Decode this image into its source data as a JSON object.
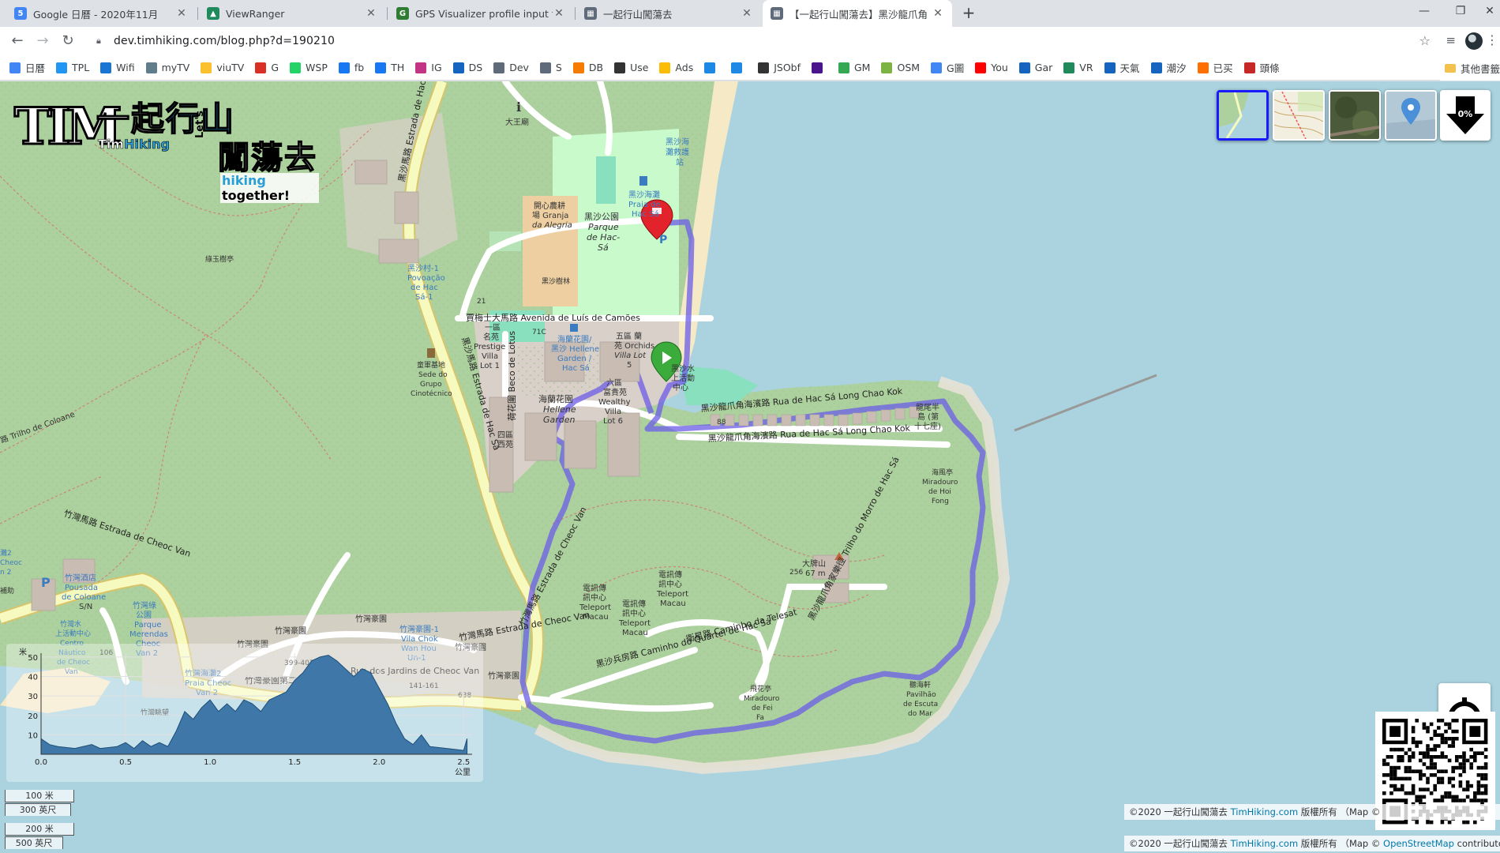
{
  "browser": {
    "tabs": [
      {
        "title": "Google 日曆 - 2020年11月",
        "favicon_color": "#4285f4",
        "favicon_text": "5"
      },
      {
        "title": "ViewRanger",
        "favicon_color": "#1f8a5c",
        "favicon_text": ""
      },
      {
        "title": "GPS Visualizer profile input form",
        "favicon_color": "#2e7d32",
        "favicon_text": "G"
      },
      {
        "title": "一起行山闖蕩去",
        "favicon_color": "#5f6b7a",
        "favicon_text": ""
      },
      {
        "title": "【一起行山闖蕩去】黑沙龍爪角",
        "favicon_color": "#5f6b7a",
        "favicon_text": ""
      }
    ],
    "active_tab_index": 4,
    "url": "dev.timhiking.com/blog.php?d=190210",
    "bookmarks": [
      {
        "label": "日曆",
        "color": "#4285f4"
      },
      {
        "label": "TPL",
        "color": "#2196f3"
      },
      {
        "label": "Wifi",
        "color": "#1976d2"
      },
      {
        "label": "myTV",
        "color": "#607d8b"
      },
      {
        "label": "viuTV",
        "color": "#fbc02d"
      },
      {
        "label": "G",
        "color": "#d93025"
      },
      {
        "label": "WSP",
        "color": "#25d366"
      },
      {
        "label": "fb",
        "color": "#1877f2"
      },
      {
        "label": "TH",
        "color": "#1877f2"
      },
      {
        "label": "IG",
        "color": "#c13584"
      },
      {
        "label": "DS",
        "color": "#1565c0"
      },
      {
        "label": "Dev",
        "color": "#5f6b7a"
      },
      {
        "label": "S",
        "color": "#5f6b7a"
      },
      {
        "label": "DB",
        "color": "#f57c00"
      },
      {
        "label": "Use",
        "color": "#333333"
      },
      {
        "label": "Ads",
        "color": "#fbbc04"
      },
      {
        "label": "",
        "color": "#1e88e5"
      },
      {
        "label": "",
        "color": "#1e88e5"
      },
      {
        "label": "JSObf",
        "color": "#333333"
      },
      {
        "label": "",
        "color": "#4a148c"
      },
      {
        "label": "GM",
        "color": "#34a853"
      },
      {
        "label": "OSM",
        "color": "#7cb342"
      },
      {
        "label": "G圖",
        "color": "#4285f4"
      },
      {
        "label": "You",
        "color": "#ff0000"
      },
      {
        "label": "Gar",
        "color": "#1565c0"
      },
      {
        "label": "VR",
        "color": "#1f8a5c"
      },
      {
        "label": "天氣",
        "color": "#1565c0"
      },
      {
        "label": "潮汐",
        "color": "#1565c0"
      },
      {
        "label": "已买",
        "color": "#ff6f00"
      },
      {
        "label": "頭條",
        "color": "#c62828"
      }
    ],
    "bookmarks_more": "»",
    "other_bookmarks": "其他書籤"
  },
  "map": {
    "logo": {
      "title_plain": "一起",
      "title_highlight": "行山",
      "subtitle_plain": "Tim",
      "subtitle_highlight": "Hiking",
      "lets": "Let's",
      "title2": "闖蕩去",
      "tagline_highlight": "hiking",
      "tagline_plain": " together!"
    },
    "layers": [
      "default-map",
      "topo-map",
      "satellite",
      "marker-view"
    ],
    "download_percent": "0%",
    "labels": {
      "dawang": "大王廟",
      "beach_station1": "黑沙海",
      "beach_station2": "灘救護",
      "beach_station3": "站",
      "beach_cn": "黑沙海灘",
      "beach_pt1": "Praia de",
      "beach_pt2": "Hac Sá",
      "park_cn": "黑沙公園",
      "park_pt1": "Parque",
      "park_pt2": "de Hac-",
      "park_pt3": "Sá",
      "farm1": "開心農耕",
      "farm2": "場 Granja",
      "farm3": "da Alegria",
      "pine": "黑沙樹林",
      "pavilion": "綠玉樹亭",
      "village1": "黑沙村-1",
      "village2": "Povoação",
      "village3": "de Hac",
      "village4": "Sá-1",
      "road_estrada_hac_sa": "黑沙馬路 Estrada de Hac Sá",
      "road_camoes": "賈梅士大馬路 Avenida de Luís de Camões",
      "prestige1": "一區",
      "prestige2": "名苑",
      "prestige3": "Prestige",
      "prestige4": "Villa",
      "prestige5": "Lot 1",
      "hellene1": "海蘭花園/",
      "hellene2": "黑沙 Hellene",
      "hellene3": "Garden /",
      "hellene4": "Hac Sá",
      "orchids1": "五區 蘭",
      "orchids2": "苑 Orchids",
      "orchids3": "Villa Lot",
      "orchids4": "5",
      "watersport1": "黑沙水",
      "watersport2": "上活動",
      "watersport3": "中心",
      "wealthy1": "六區",
      "wealthy2": "富貴苑",
      "wealthy3": "Wealthy",
      "wealthy4": "Villa",
      "wealthy5": "Lot 6",
      "hellene_garden1": "海蘭花園",
      "hellene_garden2": "Hellene",
      "hellene_garden3": "Garden",
      "west1": "四區",
      "west2": "西苑",
      "lotus": "荷花圍 Beco de Lotus",
      "scout1": "童軍基地",
      "scout2": "Sede do",
      "scout3": "Grupo",
      "scout4": "Cinotécnico",
      "coloane_trail": "路 Trilho de Coloane",
      "long_chao_kok_road": "黑沙龍爪角海濱路 Rua de Hac Sá Long Chao Kok",
      "long_chao_kok_road2": "黑沙龍爪角海濱路 Rua de Hac Sá Long Chao Kok",
      "dragon1": "龍尾半",
      "dragon2": "島 (第",
      "dragon3": "十七座)",
      "hoifong1": "海風亭",
      "hoifong2": "Miradouro",
      "hoifong3": "de Hoi",
      "hoifong4": "Fong",
      "cheoc_van_road": "竹灣馬路 Estrada de Cheoc Van",
      "cheoc_van_road2": "竹灣馬路 Estrada de Cheoc Van",
      "pousada1": "竹灣酒店",
      "pousada2": "Pousada",
      "pousada3": "de Coloane",
      "pousada4": "S/N",
      "parque1": "竹灣綠",
      "parque2": "公園",
      "parque3": "Parque",
      "parque4": "Merendas",
      "parque5": "Cheoc",
      "parque6": "Van 2",
      "teleport1": "電訊傳",
      "teleport2": "訊中心",
      "teleport3": "Teleport",
      "teleport4": "Macau",
      "quartel": "黑沙兵房路 Caminho do Quartel de Hac Sá",
      "telesat": "衛星路 Caminho da Telesat",
      "morro": "黑沙龍爪角家樂徑 Trilho do Morro de Hac Sá",
      "peak_cn": "大牌山",
      "peak_h": "67 m",
      "peak256": "256",
      "feifa1": "飛花亭",
      "feifa2": "Miradouro",
      "feifa3": "de Fei",
      "feifa4": "Fa",
      "escuta1": "聽海軒",
      "escuta2": "Pavilhão",
      "escuta3": "de Escuta",
      "escuta4": "do Mar",
      "cheocvan_vila1": "竹灣豪園",
      "cheocvan_vila2": "竹灣豪園第二街",
      "jardins": "Rua dos Jardins de Cheoc Van",
      "vila_chok1": "竹灣豪園-1",
      "vila_chok2": "Vila Chok",
      "vila_chok3": "Wan Hou",
      "vila_chok4": "Un-1",
      "num1": "399-407",
      "num2": "141-161",
      "num3": "638",
      "num4": "21",
      "num5": "88",
      "num6": "71C",
      "num7": "106",
      "beach_cheoc1": "竹灣海灘2",
      "beach_cheoc2": "Praia Cheoc",
      "beach_cheoc3": "Van 2",
      "centro1": "竹灣水",
      "centro2": "上活動中心",
      "centro3": "Centro",
      "centro4": "Náutico",
      "centro5": "de Cheoc",
      "centro6": "Van",
      "view_pavilion": "竹灣眺望",
      "left_edge1": "灘2",
      "left_edge2": "Cheoc",
      "left_edge3": "n 2",
      "left_edge4": "補助"
    }
  },
  "elevation": {
    "ylabel": "米",
    "xlabel": "公里",
    "yticks": [
      "10",
      "20",
      "30",
      "40",
      "50"
    ],
    "xticks": [
      "0.0",
      "0.5",
      "1.0",
      "1.5",
      "2.0",
      "2.5"
    ],
    "profile": [
      [
        0,
        8
      ],
      [
        0.05,
        5
      ],
      [
        0.1,
        4
      ],
      [
        0.2,
        3
      ],
      [
        0.3,
        5
      ],
      [
        0.35,
        3
      ],
      [
        0.45,
        4
      ],
      [
        0.5,
        6
      ],
      [
        0.55,
        3
      ],
      [
        0.6,
        7
      ],
      [
        0.65,
        4
      ],
      [
        0.7,
        6
      ],
      [
        0.75,
        4
      ],
      [
        0.8,
        12
      ],
      [
        0.85,
        22
      ],
      [
        0.9,
        18
      ],
      [
        0.95,
        24
      ],
      [
        1.0,
        28
      ],
      [
        1.05,
        22
      ],
      [
        1.1,
        26
      ],
      [
        1.15,
        22
      ],
      [
        1.2,
        28
      ],
      [
        1.25,
        26
      ],
      [
        1.3,
        22
      ],
      [
        1.35,
        28
      ],
      [
        1.4,
        30
      ],
      [
        1.45,
        32
      ],
      [
        1.5,
        38
      ],
      [
        1.55,
        42
      ],
      [
        1.6,
        48
      ],
      [
        1.65,
        50
      ],
      [
        1.7,
        51
      ],
      [
        1.75,
        48
      ],
      [
        1.8,
        44
      ],
      [
        1.85,
        40
      ],
      [
        1.9,
        44
      ],
      [
        1.95,
        42
      ],
      [
        2.0,
        34
      ],
      [
        2.05,
        26
      ],
      [
        2.1,
        16
      ],
      [
        2.15,
        8
      ],
      [
        2.2,
        5
      ],
      [
        2.25,
        10
      ],
      [
        2.3,
        4
      ],
      [
        2.4,
        3
      ],
      [
        2.5,
        2
      ],
      [
        2.52,
        8
      ]
    ]
  },
  "scales": [
    {
      "top": "100 米",
      "bottom": "300 英尺"
    },
    {
      "top": "200 米",
      "bottom": "500 英尺"
    }
  ],
  "attribution": {
    "line1_prefix": "©2020 一起行山闖蕩去 ",
    "line1_link": "TimHiking.com",
    "line1_suffix": " 版權所有 （Map ©",
    "line2_prefix": "©2020 一起行山闖蕩去 ",
    "line2_link": "TimHiking.com",
    "line2_mid": " 版權所有 （Map © ",
    "line2_link2": "OpenStreetMap",
    "line2_suffix": " contributors"
  }
}
